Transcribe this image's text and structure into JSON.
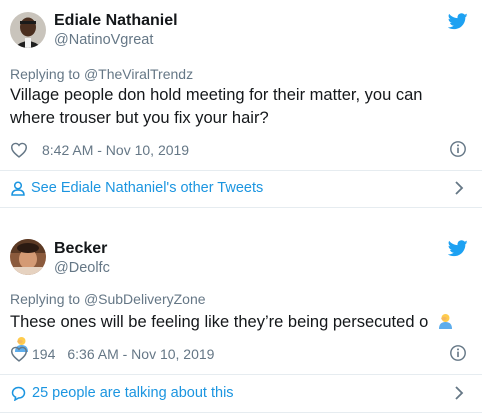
{
  "tweets": [
    {
      "author_name": "Ediale Nathaniel",
      "author_handle": "@NatinoVgreat",
      "reply_prefix": "Replying to ",
      "reply_to": "@TheViralTrendz",
      "text": "Village people don hold meeting for their matter, you can where trouser but you fix your hair?",
      "like_count": "",
      "timestamp": "8:42 AM - Nov 10, 2019",
      "footer_link": "See Ediale Nathaniel's other Tweets",
      "footer_icon": "person-icon"
    },
    {
      "author_name": "Becker",
      "author_handle": "@Deolfc",
      "reply_prefix": "Replying to ",
      "reply_to": "@SubDeliveryZone",
      "text": "These ones will be feeling like they’re being persecuted o",
      "like_count": "194",
      "timestamp": "6:36 AM - Nov 10, 2019",
      "footer_link": "25 people are talking about this",
      "footer_icon": "speech-bubble-icon"
    }
  ],
  "colors": {
    "accent": "#1b95e0",
    "twitter_blue": "#1da1f2",
    "secondary_text": "#657786",
    "border": "#e6ecf0"
  }
}
